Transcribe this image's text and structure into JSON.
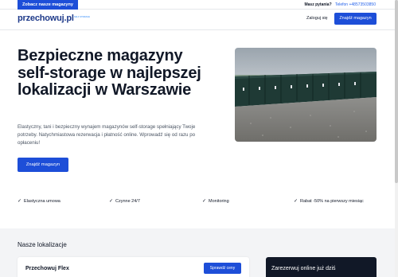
{
  "topbar": {
    "cta": "Zobacz nasze magazyny",
    "question": "Masz pytania?",
    "phone": "Telefon +48573503850"
  },
  "header": {
    "logo": "przechowuj.pl",
    "logo_tag": "SELF STORAGE",
    "login": "Zaloguj się",
    "find_button": "Znajdź magazyn"
  },
  "hero": {
    "title": "Bezpieczne magazyny self-storage w najlepszej lokalizacji w Warszawie",
    "description": "Elastyczny, tani i bezpieczny wynajem magazynów self-storage spełniający Twoje potrzeby. Natychmiastowa rezerwacja i płatność online. Wprowadź się od razu po opłaceniu!",
    "button": "Znajdź magazyn"
  },
  "features": [
    {
      "label": "Elastyczna umowa"
    },
    {
      "label": "Czynne 24/7"
    },
    {
      "label": "Monitoring"
    },
    {
      "label": "Rabat -50% na pierwszy miesiąc"
    }
  ],
  "locations": {
    "title": "Nasze lokalizacje",
    "card_name": "Przechowuj Flex",
    "card_button": "Sprawdź ceny",
    "book_title": "Zarezerwuj online już dziś"
  },
  "colors": {
    "brand": "#1d4ed8",
    "logo": "#1e3a8a",
    "container": "#1f3a35"
  }
}
